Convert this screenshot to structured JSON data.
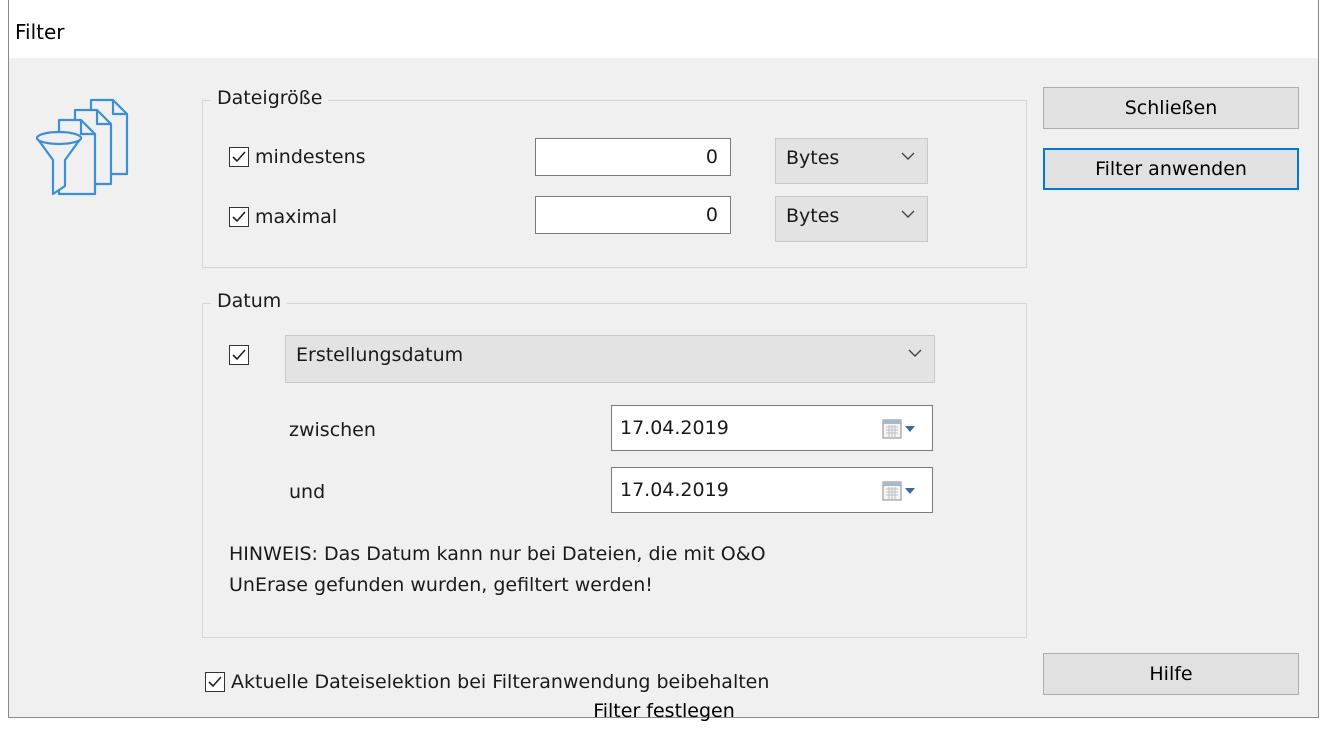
{
  "window": {
    "title": "Filter"
  },
  "groups": {
    "size": {
      "legend": "Dateigröße",
      "min": {
        "label": "mindestens",
        "checked": true,
        "value": "0",
        "unit": "Bytes"
      },
      "max": {
        "label": "maximal",
        "checked": true,
        "value": "0",
        "unit": "Bytes"
      }
    },
    "date": {
      "legend": "Datum",
      "enabled": true,
      "type": "Erstellungsdatum",
      "between_label": "zwischen",
      "between_value": "17.04.2019",
      "and_label": "und",
      "and_value": "17.04.2019",
      "note": "HINWEIS: Das Datum kann nur bei Dateien, die mit O&O UnErase gefunden wurden, gefiltert werden!"
    }
  },
  "keep_selection": {
    "label": "Aktuelle Dateiselektion bei Filteranwendung beibehalten",
    "checked": true
  },
  "buttons": {
    "close": "Schließen",
    "apply": "Filter anwenden",
    "help": "Hilfe"
  },
  "caption": "Filter festlegen",
  "colors": {
    "accent": "#0078d7",
    "icon": "#3b8ed8"
  }
}
